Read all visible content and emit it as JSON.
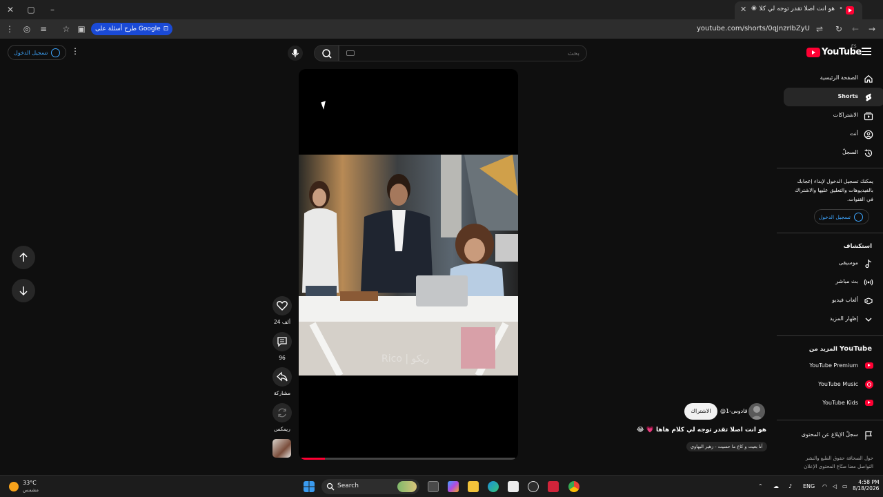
{
  "browser": {
    "tab_title": "هو انت اصلا تقدر توجه لي كلا...",
    "url": "youtube.com/shorts/0qJnzrIbZyU",
    "lens_chip_label": "طرح أسئلة على Google"
  },
  "masthead": {
    "logo_text": "YouTube",
    "country_code": "ES",
    "search_placeholder": "بحث",
    "signin_label": "تسجيل الدخول"
  },
  "guide": {
    "main_items": [
      {
        "label": "الصفحة الرئيسية",
        "icon": "home-icon"
      },
      {
        "label": "Shorts",
        "icon": "shorts-icon",
        "active": true
      },
      {
        "label": "الاشتراكات",
        "icon": "subscriptions-icon"
      },
      {
        "label": "أنت",
        "icon": "you-icon"
      },
      {
        "label": "السجلّ",
        "icon": "history-icon"
      }
    ],
    "signin_note": "يمكنك تسجيل الدخول لإبداء إعجابك بالفيديوهات والتعليق عليها والاشتراك في القنوات.",
    "signin_label": "تسجيل الدخول",
    "explore_heading": "استكشاف",
    "explore_items": [
      {
        "label": "موسيقى",
        "icon": "music-note-icon"
      },
      {
        "label": "بث مباشر",
        "icon": "live-icon"
      },
      {
        "label": "ألعاب فيديو",
        "icon": "gaming-icon"
      },
      {
        "label": "إظهار المزيد",
        "icon": "chevron-down-icon"
      }
    ],
    "more_heading_prefix": "المزيد من",
    "more_heading_brand": "YouTube",
    "more_items": [
      {
        "label": "YouTube Premium",
        "icon": "youtube-premium-icon"
      },
      {
        "label": "YouTube Music",
        "icon": "youtube-music-icon"
      },
      {
        "label": "YouTube Kids",
        "icon": "youtube-kids-icon"
      }
    ],
    "report_label": "سجلّ الإبلاغ عن المحتوى",
    "footer_line1": "حول  الصحافة  حقوق الطبع والنشر",
    "footer_line2": "التواصل معنا  صنّاع المحتوى  الإعلان"
  },
  "short": {
    "channel_handle": "@قادوس-1",
    "subscribe_label": "الاشتراك",
    "title": "هو انت اصلا تقدر توجه لي كلام هاها 💗 😂",
    "sound_label": "أنا بعيت و كاع ما حسيت - زهير البهاوي",
    "watermark": "Rico | ريكو",
    "progress": 0.11,
    "actions": {
      "like_count": "24 ألف",
      "comment_count": "96",
      "share_label": "مشاركة",
      "remix_label": "ريمكس"
    }
  },
  "taskbar": {
    "temperature": "33°C",
    "condition": "مشمس",
    "search_label": "Search",
    "language": "ENG",
    "time": "4:58 PM",
    "date": "8/18/2026"
  },
  "colors": {
    "accent_red": "#ff0033",
    "link_blue": "#3ea6ff",
    "background": "#0f0f0f"
  }
}
